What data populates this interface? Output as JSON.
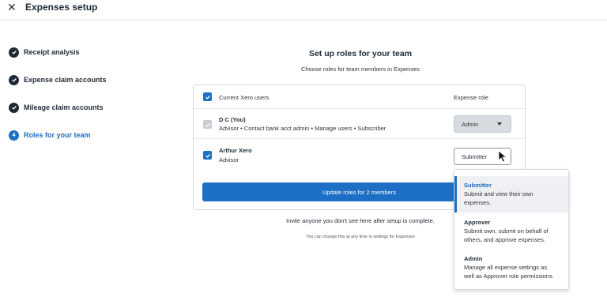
{
  "header": {
    "title": "Expenses setup",
    "close_icon": "close-icon"
  },
  "steps": [
    {
      "label": "Receipt analysis",
      "status": "complete"
    },
    {
      "label": "Expense claim accounts",
      "status": "complete"
    },
    {
      "label": "Mileage claim accounts",
      "status": "complete"
    },
    {
      "label": "Roles for your team",
      "status": "current",
      "number": "4"
    }
  ],
  "main": {
    "title": "Set up roles for your team",
    "subtitle": "Choose roles for team members in Expenses",
    "table": {
      "col_users": "Current Xero users",
      "col_role": "Expense role",
      "users": [
        {
          "name": "D C (You)",
          "description": "Advisor • Contact bank acct admin • Manage users • Subscriber",
          "role": "Admin",
          "checked": true,
          "disabled": true
        },
        {
          "name": "Arthur Xero",
          "description": "Advisor",
          "role": "Submitter",
          "checked": true,
          "disabled": false
        }
      ]
    },
    "update_button": "Update roles for 2 members",
    "invite_text": "Invite anyone you don't see here after setup is complete.",
    "change_note": "You can change this at any time in settings for Expenses"
  },
  "role_dropdown": {
    "options": [
      {
        "title": "Submitter",
        "description": [
          "Submit and view their own",
          "expenses."
        ],
        "selected": true
      },
      {
        "title": "Approver",
        "description": [
          "Submit own, submit on behalf of",
          "others, and approve expenses."
        ],
        "selected": false
      },
      {
        "title": "Admin",
        "description": [
          "Manage all expense settings as",
          "well as Approver role permissions."
        ],
        "selected": false
      }
    ]
  },
  "colors": {
    "accent": "#1c6fc4",
    "text": "#1f2a36",
    "complete_step": "#1f2a36"
  }
}
